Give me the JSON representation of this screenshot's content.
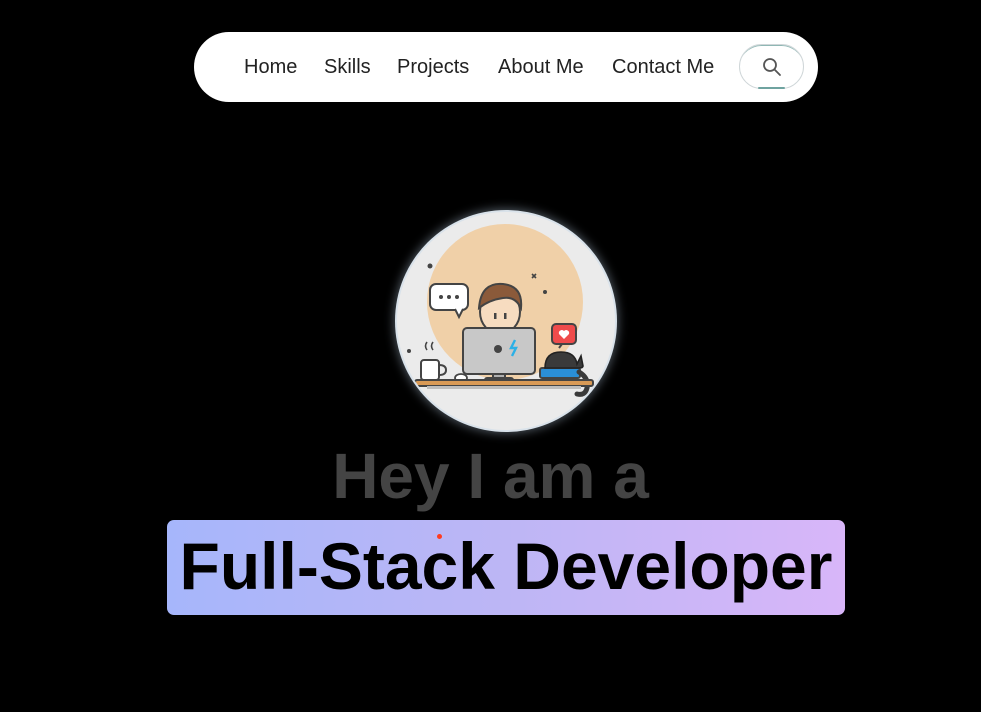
{
  "nav": {
    "items": [
      {
        "label": "Home"
      },
      {
        "label": "Skills"
      },
      {
        "label": "Projects"
      },
      {
        "label": "About Me"
      },
      {
        "label": "Contact Me"
      }
    ],
    "search_icon": "search-icon"
  },
  "avatar": {
    "description_icon": "developer-illustration",
    "speech_bubble_text": "..."
  },
  "hero": {
    "intro": "Hey I am a",
    "role": "Full-Stack Developer"
  },
  "colors": {
    "background": "#000000",
    "nav_bg": "#ffffff",
    "intro_text": "#444444",
    "role_gradient_start": "#a6b6fb",
    "role_gradient_end": "#d8b6f9"
  }
}
